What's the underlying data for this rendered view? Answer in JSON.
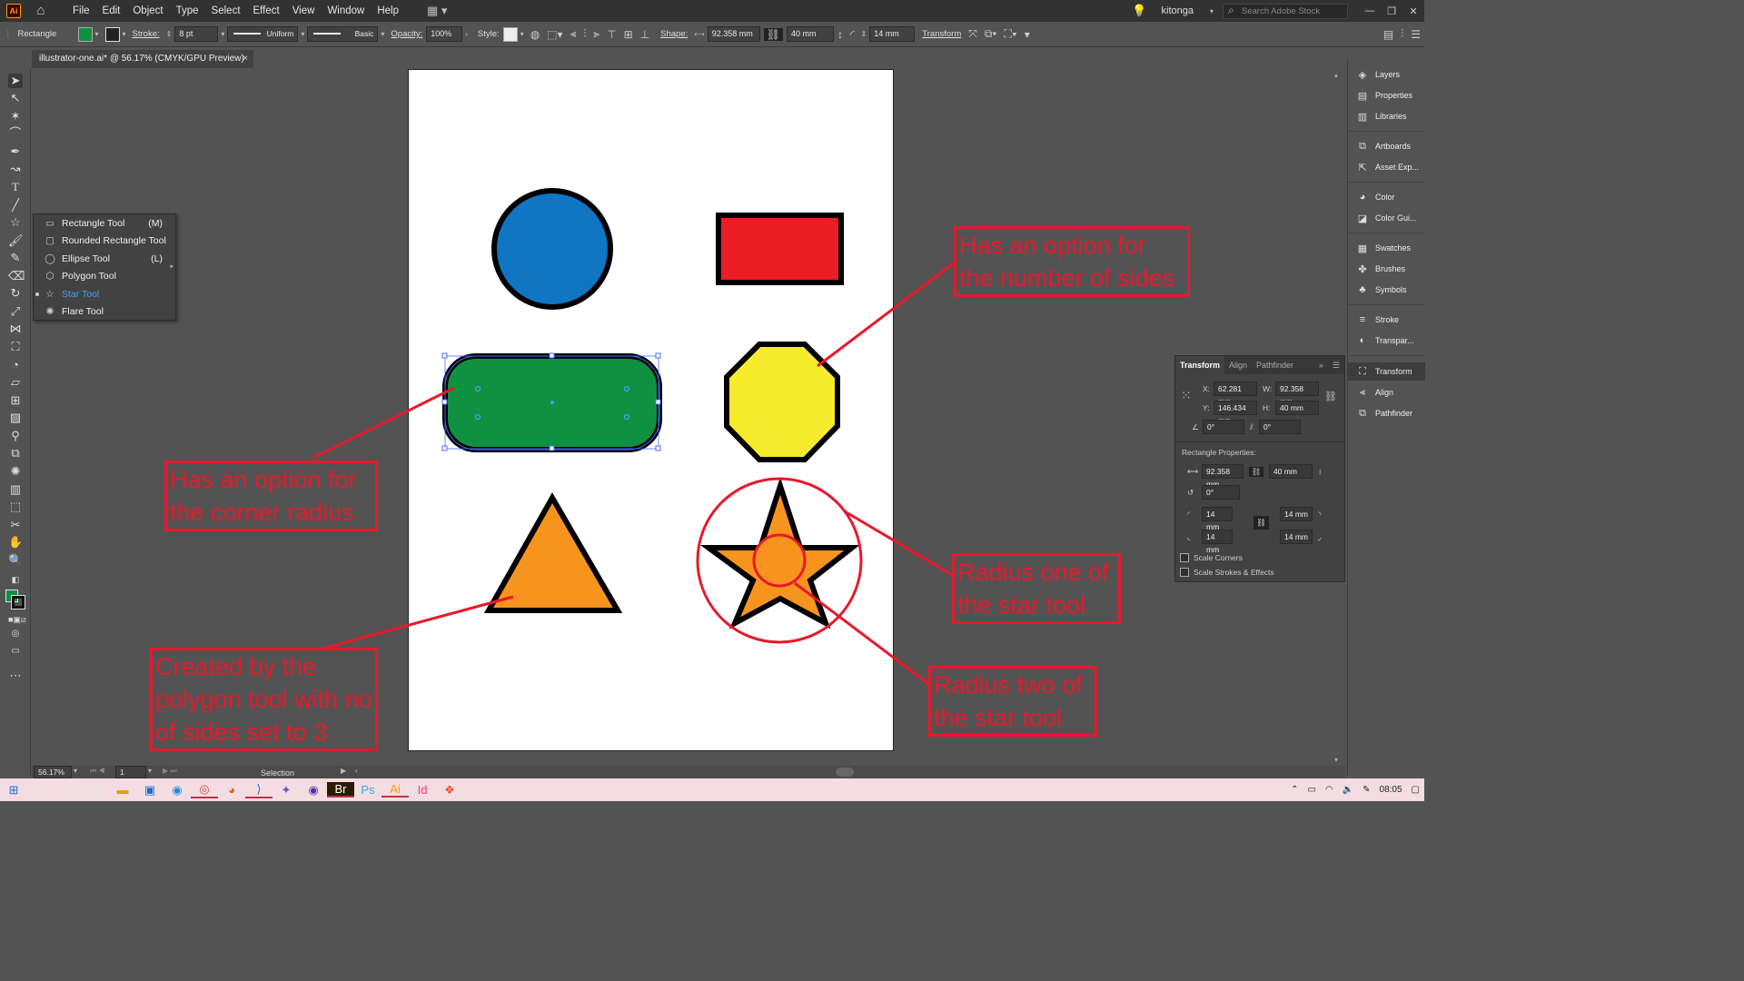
{
  "app": {
    "logo": "Ai",
    "user": "kitonga",
    "stock_placeholder": "Search Adobe Stock"
  },
  "menu": [
    "File",
    "Edit",
    "Object",
    "Type",
    "Select",
    "Effect",
    "View",
    "Window",
    "Help"
  ],
  "control": {
    "object_type": "Rectangle",
    "stroke_label": "Stroke:",
    "stroke_weight": "8 pt",
    "stroke_profile": "Uniform",
    "brush": "Basic",
    "opacity_label": "Opacity:",
    "opacity": "100%",
    "style_label": "Style:",
    "shape_label": "Shape:",
    "shape_w": "92.358 mm",
    "shape_h": "40 mm",
    "corner": "14 mm",
    "transform_label": "Transform",
    "fill_color": "#0f9142"
  },
  "doc_tab": {
    "title": "illustrator-one.ai* @ 56.17% (CMYK/GPU Preview)",
    "close": "×"
  },
  "flyout": [
    {
      "label": "Rectangle Tool",
      "shortcut": "(M)",
      "icon": "rectangle-icon"
    },
    {
      "label": "Rounded Rectangle Tool",
      "shortcut": "",
      "icon": "rounded-rectangle-icon"
    },
    {
      "label": "Ellipse Tool",
      "shortcut": "(L)",
      "icon": "ellipse-icon"
    },
    {
      "label": "Polygon Tool",
      "shortcut": "",
      "icon": "polygon-icon"
    },
    {
      "label": "Star Tool",
      "shortcut": "",
      "icon": "star-icon"
    },
    {
      "label": "Flare Tool",
      "shortcut": "",
      "icon": "flare-icon"
    }
  ],
  "annotations": {
    "sides": "Has an option for the number of sides",
    "corner": "Has an option for the corner radius",
    "radius1": "Radius one of the star tool",
    "polygon": "Created by the polygon tool with no of sides set to 3",
    "radius2": "Radius two of the star tool"
  },
  "shape_colors": {
    "circle": "#1075c3",
    "rect": "#ec1c24",
    "rounded": "#0f9142",
    "octagon": "#f5ec2e",
    "triangle": "#f7941d",
    "star": "#f7941d",
    "annot": "#e8182b"
  },
  "right_panels": [
    {
      "label": "Layers",
      "icon": "layers-icon"
    },
    {
      "label": "Properties",
      "icon": "properties-icon"
    },
    {
      "label": "Libraries",
      "icon": "libraries-icon"
    },
    {
      "label": "Artboards",
      "icon": "artboards-icon"
    },
    {
      "label": "Asset Exp...",
      "icon": "asset-export-icon"
    },
    {
      "label": "Color",
      "icon": "color-icon"
    },
    {
      "label": "Color Gui...",
      "icon": "color-guide-icon"
    },
    {
      "label": "Swatches",
      "icon": "swatches-icon"
    },
    {
      "label": "Brushes",
      "icon": "brushes-icon"
    },
    {
      "label": "Symbols",
      "icon": "symbols-icon"
    },
    {
      "label": "Stroke",
      "icon": "stroke-icon"
    },
    {
      "label": "Transpar...",
      "icon": "transparency-icon"
    },
    {
      "label": "Transform",
      "icon": "transform-icon"
    },
    {
      "label": "Align",
      "icon": "align-icon"
    },
    {
      "label": "Pathfinder",
      "icon": "pathfinder-icon"
    }
  ],
  "transform_panel": {
    "tabs": [
      "Transform",
      "Align",
      "Pathfinder"
    ],
    "x_label": "X:",
    "x": "62.281 mm",
    "y_label": "Y:",
    "y": "146.434 mm",
    "w_label": "W:",
    "w": "92.358 mm",
    "h_label": "H:",
    "h": "40 mm",
    "rotate": "0°",
    "shear": "0°",
    "rect_props": "Rectangle Properties:",
    "rp_w": "92.358 mm",
    "rp_h": "40 mm",
    "rp_angle": "0°",
    "c1": "14 mm",
    "c2": "14 mm",
    "c3": "14 mm",
    "c4": "14 mm",
    "scale_corners": "Scale Corners",
    "scale_strokes": "Scale Strokes & Effects"
  },
  "status": {
    "zoom": "56.17%",
    "page": "1",
    "tool": "Selection"
  },
  "taskbar": {
    "time": "08:05"
  }
}
